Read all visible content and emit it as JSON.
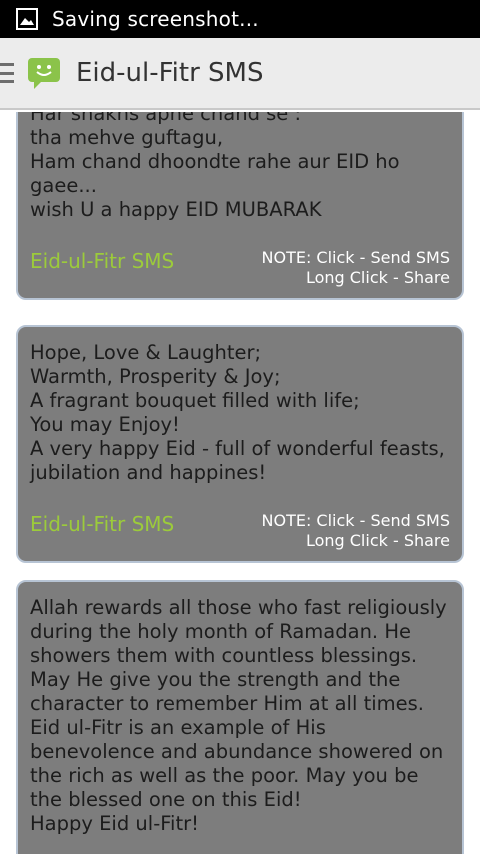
{
  "status_bar": {
    "text": "Saving screenshot...",
    "icon": "image-icon"
  },
  "action_bar": {
    "title": "Eid-ul-Fitr SMS",
    "drawer_icon": "drawer-menu-icon",
    "app_icon": "sms-smiley-icon",
    "accent_color": "#8bc34a"
  },
  "cards": [
    {
      "text": "Har shakhs apne chand se :\ntha mehve guftagu,\nHam chand dhoondte rahe aur EID ho gaee...\nwish U a happy EID MUBARAK",
      "app_name": "Eid-ul-Fitr SMS",
      "note_line1": "NOTE: Click - Send SMS",
      "note_line2": "Long Click - Share"
    },
    {
      "text": "Hope, Love & Laughter;\nWarmth, Prosperity & Joy;\nA fragrant bouquet filled with life;\nYou may Enjoy!\nA very happy Eid - full of wonderful feasts, jubilation and happines!",
      "app_name": "Eid-ul-Fitr SMS",
      "note_line1": "NOTE: Click - Send SMS",
      "note_line2": "Long Click - Share"
    },
    {
      "text": "Allah rewards all those who fast religiously during the holy month of Ramadan. He showers them with countless blessings. May He give you the strength and the character to remember Him at all times. Eid ul-Fitr is an example of His benevolence and abundance showered on the rich as well as the poor. May you be the blessed one on this Eid!\nHappy Eid ul-Fitr!"
    }
  ]
}
